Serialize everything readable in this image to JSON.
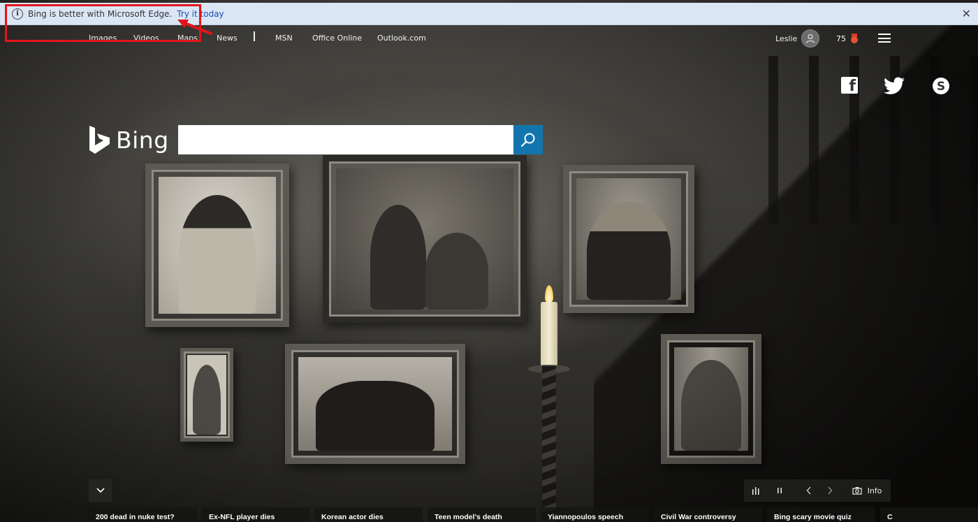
{
  "edge_banner": {
    "message": "Bing is better with Microsoft Edge.",
    "cta": "Try it today",
    "close_glyph": "✕"
  },
  "nav": {
    "items": [
      "Images",
      "Videos",
      "Maps",
      "News",
      "MSN",
      "Office Online",
      "Outlook.com"
    ]
  },
  "user": {
    "name": "Leslie",
    "reward_points": "75"
  },
  "search": {
    "logo_text": "Bing",
    "placeholder": "",
    "value": ""
  },
  "controls": {
    "info_label": "Info"
  },
  "news": {
    "items": [
      "200 dead in nuke test?",
      "Ex-NFL player dies",
      "Korean actor dies",
      "Teen model's death",
      "Yiannopoulos speech",
      "Civil War controversy",
      "Bing scary movie quiz",
      "C"
    ]
  },
  "colors": {
    "search_button": "#1375ad",
    "banner_bg": "#dbe6f5",
    "cta_link": "#1a4fb0",
    "highlight": "#e3151a"
  }
}
